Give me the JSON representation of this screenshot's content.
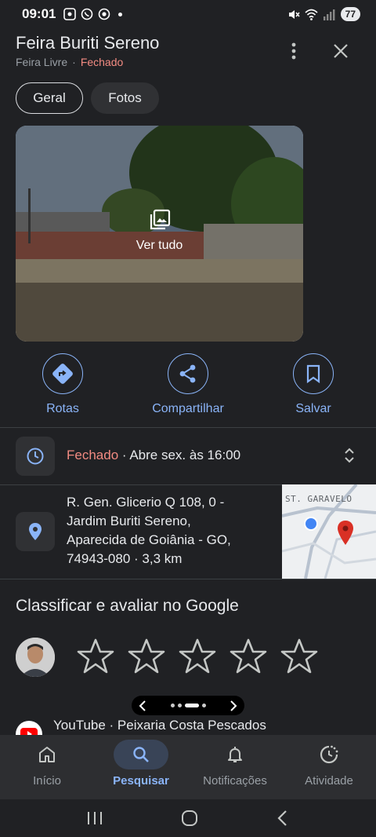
{
  "status_bar": {
    "time": "09:01",
    "battery": "77"
  },
  "place": {
    "title": "Feira Buriti Sereno",
    "category": "Feira Livre",
    "separator": "·",
    "status": "Fechado"
  },
  "tabs": [
    {
      "label": "Geral",
      "selected": true
    },
    {
      "label": "Fotos",
      "selected": false
    }
  ],
  "photo": {
    "view_all_label": "Ver tudo"
  },
  "actions": [
    {
      "label": "Rotas",
      "icon": "directions-icon"
    },
    {
      "label": "Compartilhar",
      "icon": "share-icon"
    },
    {
      "label": "Salvar",
      "icon": "bookmark-icon"
    }
  ],
  "hours": {
    "status": "Fechado",
    "detail": " · Abre sex. às 16:00"
  },
  "address": {
    "line1": "R. Gen. Glicerio Q 108, 0 -",
    "line2": "Jardim Buriti Sereno,",
    "line3": "Aparecida de Goiânia - GO,",
    "line4": "74943-080  ·  3,3 km",
    "map_label": "ST. GARAVELO"
  },
  "rating": {
    "title": "Classificar e avaliar no Google",
    "stars": 5
  },
  "carousel": {
    "item_text": "YouTube · Peixaria Costa Pescados"
  },
  "bottom_nav": [
    {
      "label": "Início",
      "icon": "home-icon",
      "active": false
    },
    {
      "label": "Pesquisar",
      "icon": "search-icon",
      "active": true
    },
    {
      "label": "Notificações",
      "icon": "bell-icon",
      "active": false
    },
    {
      "label": "Atividade",
      "icon": "activity-icon",
      "active": false
    }
  ],
  "colors": {
    "background": "#202124",
    "accent": "#8ab4f8",
    "closed": "#f28b82",
    "text": "#e8eaed",
    "muted": "#9aa0a6"
  }
}
